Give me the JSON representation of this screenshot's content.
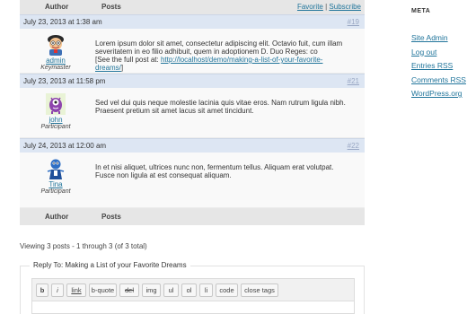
{
  "topic": {
    "header": {
      "author_label": "Author",
      "posts_label": "Posts",
      "favorite_label": "Favorite",
      "separator": "|",
      "subscribe_label": "Subscribe"
    },
    "posts": [
      {
        "date": "July 23, 2013 at 1:38 am",
        "id": "#19",
        "author": "admin",
        "role": "Keymaster",
        "avatar_icon": "cartoon-man-avatar-icon",
        "text": "Lorem ipsum dolor sit amet, consectetur adipiscing elit. Octavio fuit, cum illam severitatem in eo filio adhibuit, quem in adoptionem D. Duo Reges: co",
        "link_prefix": "[See the full post at: ",
        "link_text": "http://localhost/demo/making-a-list-of-your-favorite-dreams/",
        "link_suffix": "]"
      },
      {
        "date": "July 23, 2013 at 11:58 pm",
        "id": "#21",
        "author": "john",
        "role": "Participant",
        "avatar_icon": "purple-monster-avatar-icon",
        "text": "Sed vel dui quis neque molestie lacinia quis vitae eros. Nam rutrum ligula nibh. Praesent pretium sit amet lacus sit amet tincidunt."
      },
      {
        "date": "July 24, 2013 at 12:00 am",
        "id": "#22",
        "author": "Tina",
        "role": "Participant",
        "avatar_icon": "blue-character-avatar-icon",
        "text": "In et nisi aliquet, ultrices nunc non, fermentum tellus. Aliquam erat volutpat. Fusce non ligula at est consequat aliquam."
      }
    ],
    "footer": {
      "author_label": "Author",
      "posts_label": "Posts"
    }
  },
  "pagination": {
    "viewing_text": "Viewing 3 posts - 1 through 3 (of 3 total)"
  },
  "reply": {
    "legend": "Reply To: Making a List of your Favorite Dreams",
    "toolbar": [
      "b",
      "i",
      "link",
      "b-quote",
      "del",
      "img",
      "ul",
      "ol",
      "li",
      "code",
      "close tags"
    ]
  },
  "sidebar": {
    "title": "META",
    "links": [
      "Site Admin",
      "Log out",
      "Entries RSS",
      "Comments RSS",
      "WordPress.org"
    ]
  },
  "colors": {
    "link": "#21759b",
    "meta_row": "#dde6f3",
    "header_bar": "#e6e6e6",
    "post_body": "#f9f9f9"
  }
}
